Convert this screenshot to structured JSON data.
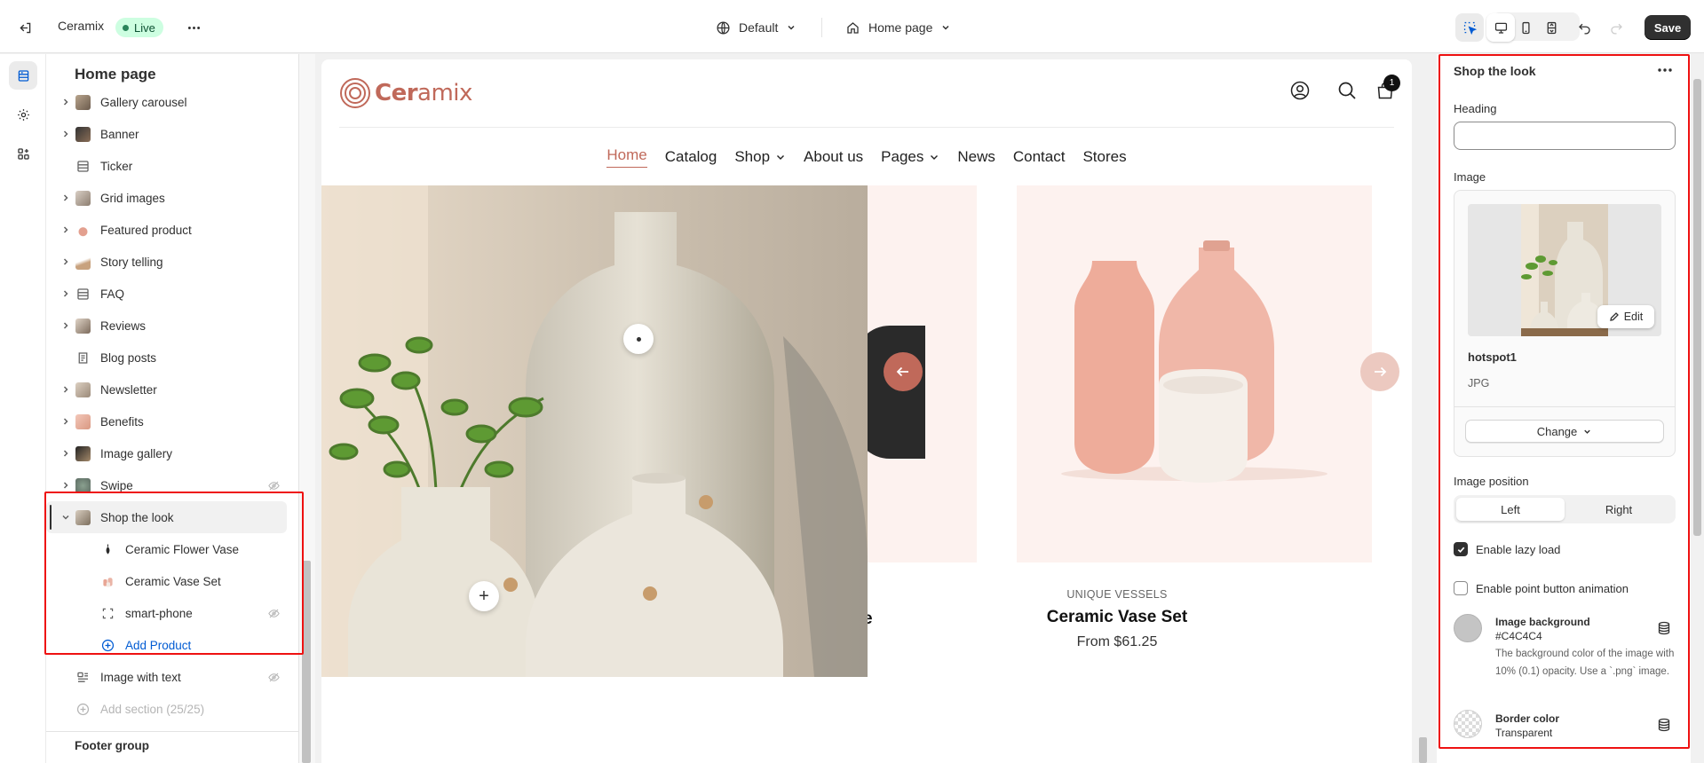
{
  "topbar": {
    "store_name": "Ceramix",
    "status_badge": "Live",
    "theme_selector": "Default",
    "page_selector": "Home page",
    "save_label": "Save"
  },
  "sections_panel": {
    "title": "Home page",
    "items": [
      {
        "label": "Gallery carousel",
        "expandable": true,
        "hidden": false
      },
      {
        "label": "Banner",
        "expandable": true,
        "hidden": false
      },
      {
        "label": "Ticker",
        "expandable": false,
        "hidden": false
      },
      {
        "label": "Grid images",
        "expandable": true,
        "hidden": false
      },
      {
        "label": "Featured product",
        "expandable": true,
        "hidden": false
      },
      {
        "label": "Story telling",
        "expandable": true,
        "hidden": false
      },
      {
        "label": "FAQ",
        "expandable": true,
        "hidden": false
      },
      {
        "label": "Reviews",
        "expandable": true,
        "hidden": false
      },
      {
        "label": "Blog posts",
        "expandable": false,
        "hidden": false
      },
      {
        "label": "Newsletter",
        "expandable": true,
        "hidden": false
      },
      {
        "label": "Benefits",
        "expandable": true,
        "hidden": false
      },
      {
        "label": "Image gallery",
        "expandable": true,
        "hidden": false
      },
      {
        "label": "Swipe",
        "expandable": true,
        "hidden": true
      },
      {
        "label": "Shop the look",
        "expandable": true,
        "expanded": true,
        "selected": true,
        "hidden": false
      }
    ],
    "shop_the_look_blocks": [
      {
        "label": "Ceramic Flower Vase",
        "hidden": false
      },
      {
        "label": "Ceramic Vase Set",
        "hidden": false
      },
      {
        "label": "smart-phone",
        "hidden": true
      }
    ],
    "add_product_label": "Add Product",
    "after_items": [
      {
        "label": "Image with text",
        "hidden": true
      }
    ],
    "add_section_label": "Add section (25/25)",
    "footer_group_label": "Footer group"
  },
  "preview": {
    "logo_text_bold": "Cer",
    "logo_text_light": "amix",
    "cart_count": "1",
    "nav": [
      {
        "label": "Home",
        "active": true,
        "dropdown": false
      },
      {
        "label": "Catalog",
        "active": false,
        "dropdown": false
      },
      {
        "label": "Shop",
        "active": false,
        "dropdown": true
      },
      {
        "label": "About us",
        "active": false,
        "dropdown": false
      },
      {
        "label": "Pages",
        "active": false,
        "dropdown": true
      },
      {
        "label": "News",
        "active": false,
        "dropdown": false
      },
      {
        "label": "Contact",
        "active": false,
        "dropdown": false
      },
      {
        "label": "Stores",
        "active": false,
        "dropdown": false
      }
    ],
    "product": {
      "vendor": "UNIQUE VESSELS",
      "title": "Ceramic Vase Set",
      "price": "From $61.25"
    },
    "cut_title_fragment": "e",
    "colors": {
      "brand": "#c0695a",
      "card_bg": "#fdf2ef",
      "prev_arrow": "#c0695a",
      "next_arrow": "#ecc9c0"
    }
  },
  "settings_panel": {
    "title": "Shop the look",
    "heading_label": "Heading",
    "heading_value": "",
    "image_label": "Image",
    "image_name": "hotspot1",
    "image_type": "JPG",
    "edit_label": "Edit",
    "change_label": "Change",
    "image_position_label": "Image position",
    "position_options": [
      "Left",
      "Right"
    ],
    "position_selected": "Left",
    "lazy_load_label": "Enable lazy load",
    "lazy_load_checked": true,
    "point_anim_label": "Enable point button animation",
    "point_anim_checked": false,
    "image_bg_title": "Image background",
    "image_bg_value": "#C4C4C4",
    "image_bg_desc": "The background color of the image with 10% (0.1) opacity. Use a `.png` image.",
    "border_color_title": "Border color",
    "border_color_value": "Transparent"
  }
}
